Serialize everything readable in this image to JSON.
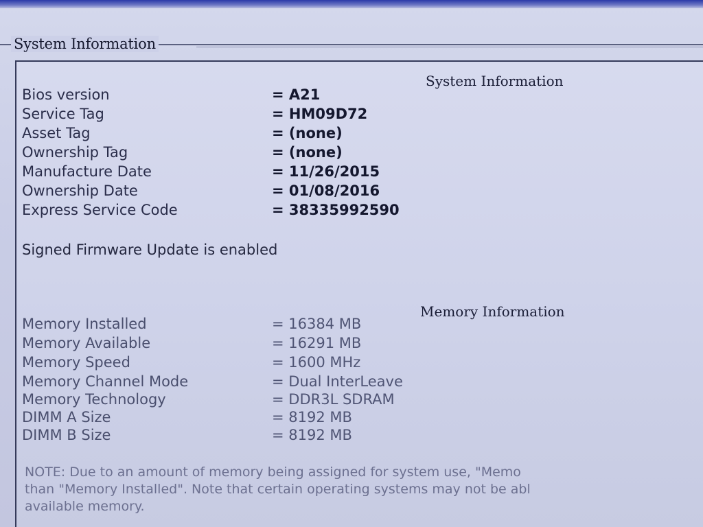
{
  "group_title": "System Information",
  "system": {
    "heading": "System Information",
    "rows": [
      {
        "label": "Bios version",
        "value": "= A21"
      },
      {
        "label": "Service Tag",
        "value": "= HM09D72"
      },
      {
        "label": "Asset Tag",
        "value": "= (none)"
      },
      {
        "label": "Ownership Tag",
        "value": "= (none)"
      },
      {
        "label": "Manufacture Date",
        "value": "= 11/26/2015"
      },
      {
        "label": "Ownership Date",
        "value": "= 01/08/2016"
      },
      {
        "label": "Express Service Code",
        "value": "= 38335992590"
      }
    ],
    "firmware_status": "Signed Firmware Update is enabled"
  },
  "memory": {
    "heading": "Memory Information",
    "rows": [
      {
        "label": "Memory Installed",
        "value": "= 16384 MB"
      },
      {
        "label": "Memory Available",
        "value": "= 16291 MB"
      },
      {
        "label": "Memory Speed",
        "value": "= 1600 MHz"
      },
      {
        "label": "Memory Channel Mode",
        "value": "= Dual InterLeave"
      },
      {
        "label": "Memory Technology",
        "value": "= DDR3L SDRAM"
      },
      {
        "label": "DIMM A Size",
        "value": "= 8192 MB"
      },
      {
        "label": "DIMM B Size",
        "value": "= 8192 MB"
      }
    ],
    "note_lines": [
      "NOTE: Due to an amount of memory being assigned for system use, \"Memo",
      "than \"Memory Installed\". Note that certain operating systems may not be abl",
      "available memory."
    ]
  }
}
